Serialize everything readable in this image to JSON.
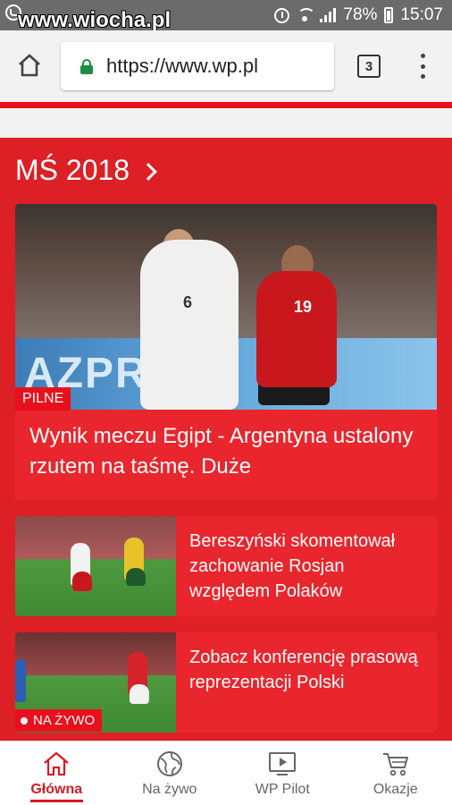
{
  "status_bar": {
    "watermark": "www.wiocha.pl",
    "battery": "78%",
    "time": "15:07"
  },
  "browser": {
    "url": "https://www.wp.pl",
    "tab_count": "3"
  },
  "section": {
    "title": "MŚ 2018"
  },
  "hero": {
    "badge": "PILNE",
    "title": "Wynik meczu Egipt - Argentyna ustalony rzutem na taśmę. Duże",
    "image_ad_text": "AZPRO",
    "jersey_white": "6",
    "jersey_red": "19"
  },
  "articles": [
    {
      "title": "Bereszyński skomentował zachowanie Rosjan względem Polaków"
    },
    {
      "title": "Zobacz konferencję prasową reprezentacji Polski",
      "badge": "NA ŻYWO"
    }
  ],
  "bottom_nav": [
    {
      "label": "Główna",
      "icon": "home-icon",
      "active": true
    },
    {
      "label": "Na żywo",
      "icon": "globe-icon",
      "active": false
    },
    {
      "label": "WP Pilot",
      "icon": "tv-play-icon",
      "active": false
    },
    {
      "label": "Okazje",
      "icon": "cart-icon",
      "active": false
    }
  ],
  "colors": {
    "brand_red": "#dd1f26",
    "badge_red": "#e8101c",
    "secure_green": "#1e8e3e"
  }
}
